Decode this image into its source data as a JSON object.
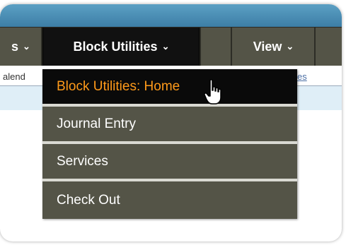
{
  "menubar": {
    "items": [
      {
        "label": "s",
        "chevron": "⌄"
      },
      {
        "label": "Block Utilities",
        "chevron": "⌄"
      },
      {
        "label": "View",
        "chevron": "⌄"
      }
    ]
  },
  "subbar": {
    "left_fragment": "alend",
    "right_fragment": "es"
  },
  "dropdown": {
    "items": [
      {
        "label": "Block Utilities: Home"
      },
      {
        "label": "Journal Entry"
      },
      {
        "label": "Services"
      },
      {
        "label": "Check Out"
      }
    ]
  },
  "colors": {
    "menubar_bg": "#545447",
    "active_bg": "#111111",
    "highlight_text": "#ff9a1a",
    "top_band": "#3d7ea6",
    "sub_bar": "#dfeef7"
  },
  "icons": {
    "chevron": "chevron-down-icon",
    "cursor": "hand-pointer-icon"
  }
}
